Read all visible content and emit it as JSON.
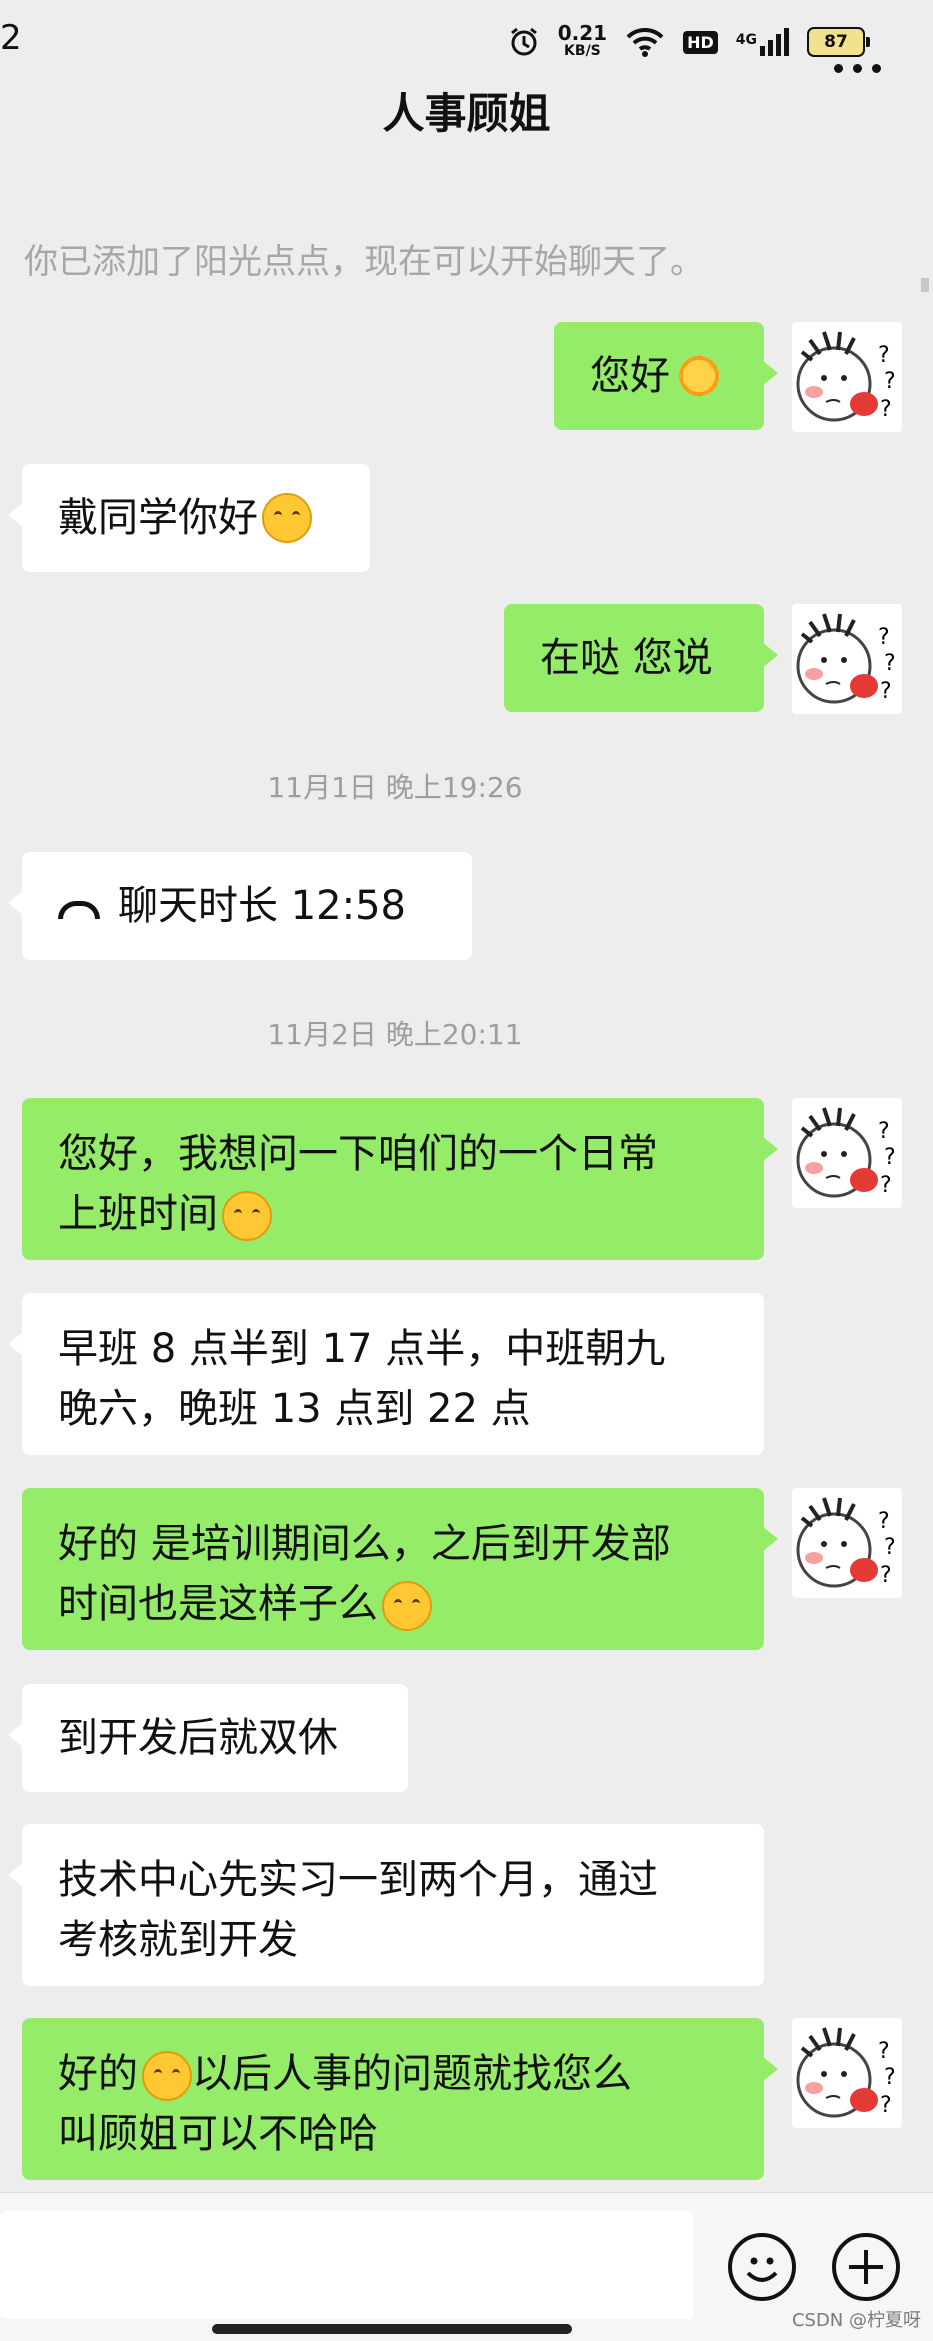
{
  "status_bar": {
    "time": "2",
    "speed_value": "0.21",
    "speed_unit": "KB/S",
    "hd_label": "HD",
    "network_label": "4G",
    "battery": "87",
    "icons": [
      "alarm-icon",
      "wifi-icon",
      "signal-icon",
      "battery-icon"
    ]
  },
  "header": {
    "title": "人事顾姐",
    "more_icon": "more-icon"
  },
  "system_message": "你已添加了阳光点点，现在可以开始聊天了。",
  "messages": {
    "m1": {
      "text": "您好",
      "emoji": "sun-emoji"
    },
    "m2": {
      "text": "戴同学你好",
      "emoji": "grin-emoji"
    },
    "m3": {
      "text": "在哒 您说"
    },
    "ts1": "11月1日 晚上19:26",
    "m4": {
      "text": "聊天时长 12:58",
      "icon": "phone-hangup-icon"
    },
    "ts2": "11月2日 晚上20:11",
    "m5": {
      "line1": "您好，我想问一下咱们的一个日常",
      "line2": "上班时间",
      "emoji": "smile-emoji"
    },
    "m6": {
      "line1": "早班 8 点半到 17 点半，中班朝九",
      "line2": "晚六，晚班 13 点到 22 点"
    },
    "m7": {
      "line1": "好的 是培训期间么，之后到开发部",
      "line2": "时间也是这样子么",
      "emoji": "thinking-emoji"
    },
    "m8": {
      "text": "到开发后就双休"
    },
    "m9": {
      "line1": "技术中心先实习一到两个月，通过",
      "line2": "考核就到开发"
    },
    "m10": {
      "line1": "好的",
      "line1b": "以后人事的问题就找您么",
      "line2": "叫顾姐可以不哈哈",
      "emoji": "hug-emoji"
    }
  },
  "input_bar": {
    "emoji_button_icon": "smiley-icon",
    "plus_button_icon": "plus-icon"
  },
  "watermark": "CSDN @柠夏呀"
}
